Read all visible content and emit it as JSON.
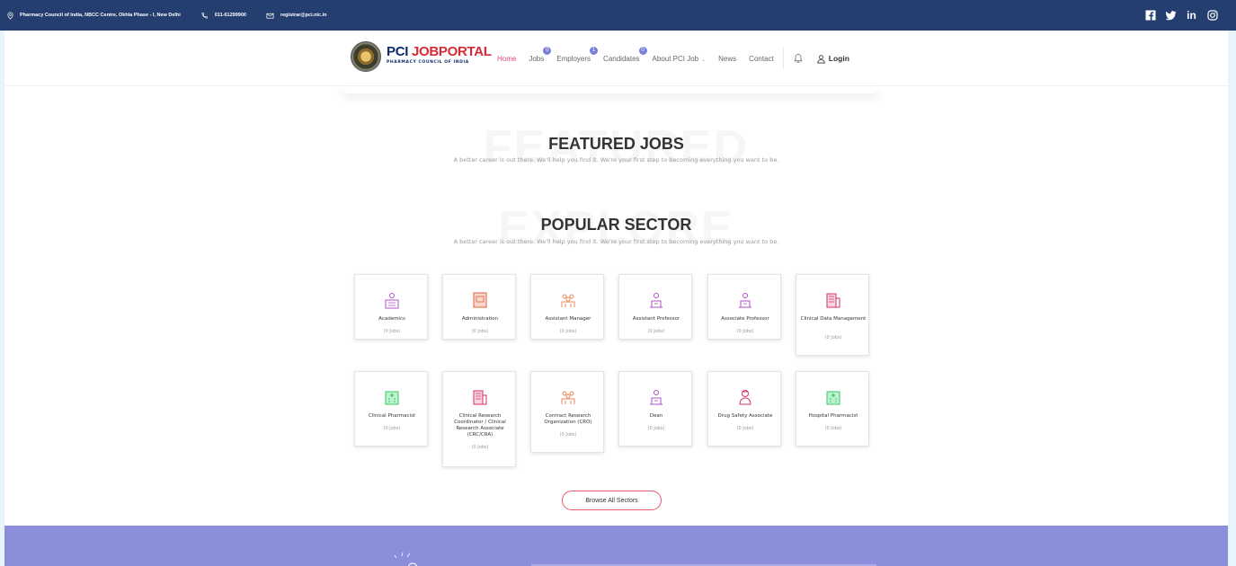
{
  "topbar": {
    "address": "Pharmacy Council of India, NBCC Centre, Okhla Phase - I, New Delhi",
    "phone": "011-61299900",
    "email": "registrar@pci.nic.in",
    "social_icons": [
      "facebook-icon",
      "twitter-icon",
      "linkedin-icon",
      "instagram-icon"
    ]
  },
  "logo": {
    "name_part1": "PCI ",
    "name_part2": "JOBPORTAL",
    "subtitle": "PHARMACY COUNCIL OF INDIA"
  },
  "nav": {
    "home": "Home",
    "jobs": "Jobs",
    "jobs_badge": "0",
    "employers": "Employers",
    "employers_badge": "1",
    "candidates": "Candidates",
    "candidates_badge": "0",
    "about": "About PCI Job",
    "news": "News",
    "contact": "Contact",
    "login": "Login"
  },
  "featured": {
    "ghost": "FEATURED",
    "title": "FEATURED JOBS",
    "subtitle": "A better career is out there. We'll help you find it. We're your first step to becoming everything you want to be."
  },
  "popular": {
    "ghost": "EXPLORE",
    "title": "POPULAR SECTOR",
    "subtitle": "A better career is out there. We'll help you find it. We're your first step to becoming everything you want to be."
  },
  "sectors": [
    {
      "name": "Academics",
      "count": "(0 Jobs)",
      "icon": "academics-icon",
      "color": "#b04fc8"
    },
    {
      "name": "Administration",
      "count": "(0 Jobs)",
      "icon": "administration-icon",
      "color": "#e0603a"
    },
    {
      "name": "Assistant Manager",
      "count": "(0 Jobs)",
      "icon": "team-icon",
      "color": "#e98a5a"
    },
    {
      "name": "Assistant Professor",
      "count": "(0 Jobs)",
      "icon": "professor-icon",
      "color": "#b04fc8"
    },
    {
      "name": "Associate Professor",
      "count": "(0 Jobs)",
      "icon": "professor-icon",
      "color": "#b04fc8"
    },
    {
      "name": "Clinical Data Management",
      "count": "(0 Jobs)",
      "icon": "building-icon",
      "color": "#d62f6a"
    },
    {
      "name": "Clinical Pharmacist",
      "count": "(0 Jobs)",
      "icon": "hospital-icon",
      "color": "#33cc66"
    },
    {
      "name": "Clinical Research Coordinator / Clinical Research Associate (CRC/CRA)",
      "count": "(0 Jobs)",
      "icon": "building-icon",
      "color": "#d62f6a"
    },
    {
      "name": "Contract Research Organization (CRO)",
      "count": "(0 Jobs)",
      "icon": "team-icon",
      "color": "#e98a5a"
    },
    {
      "name": "Dean",
      "count": "(0 Jobs)",
      "icon": "professor-icon",
      "color": "#b04fc8"
    },
    {
      "name": "Drug Safety Associate",
      "count": "(0 Jobs)",
      "icon": "doctor-icon",
      "color": "#d62f6a"
    },
    {
      "name": "Hospital Pharmacist",
      "count": "(0 Jobs)",
      "icon": "hospital-icon",
      "color": "#33cc66"
    }
  ],
  "browse_label": "Browse All Sectors"
}
